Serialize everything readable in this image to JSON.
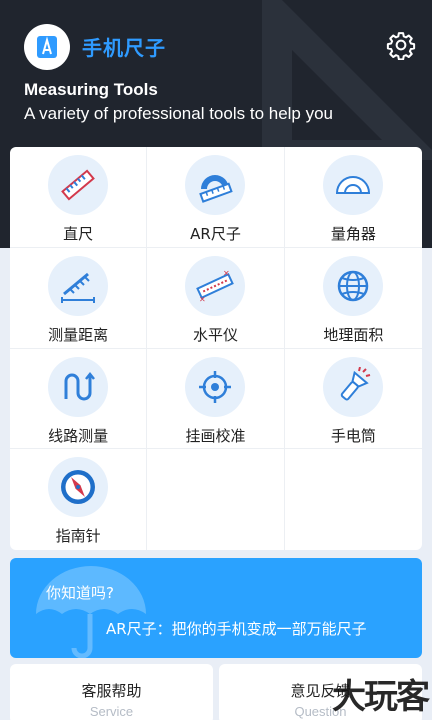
{
  "header": {
    "app_name": "手机尺子",
    "title": "Measuring Tools",
    "subtitle": "A variety of professional tools to help you",
    "settings_icon": "gear-icon"
  },
  "tools": [
    {
      "label": "直尺",
      "icon": "ruler-icon"
    },
    {
      "label": "AR尺子",
      "icon": "ar-ruler-icon"
    },
    {
      "label": "量角器",
      "icon": "protractor-icon"
    },
    {
      "label": "测量距离",
      "icon": "measure-distance-icon"
    },
    {
      "label": "水平仪",
      "icon": "level-icon"
    },
    {
      "label": "地理面积",
      "icon": "globe-icon"
    },
    {
      "label": "线路测量",
      "icon": "route-icon"
    },
    {
      "label": "挂画校准",
      "icon": "target-icon"
    },
    {
      "label": "手电筒",
      "icon": "flashlight-icon"
    },
    {
      "label": "指南针",
      "icon": "compass-icon"
    }
  ],
  "tip": {
    "question": "你知道吗?",
    "text": "AR尺子：把你的手机变成一部万能尺子"
  },
  "bottom_buttons": [
    {
      "cn": "客服帮助",
      "en": "Service"
    },
    {
      "cn": "意见反馈",
      "en": "Question"
    }
  ],
  "watermark": "大玩客",
  "colors": {
    "accent": "#2f9bff",
    "header_bg": "#20252e",
    "tip_bg": "#2aa2ff",
    "icon_bg": "#e6f0fb"
  }
}
